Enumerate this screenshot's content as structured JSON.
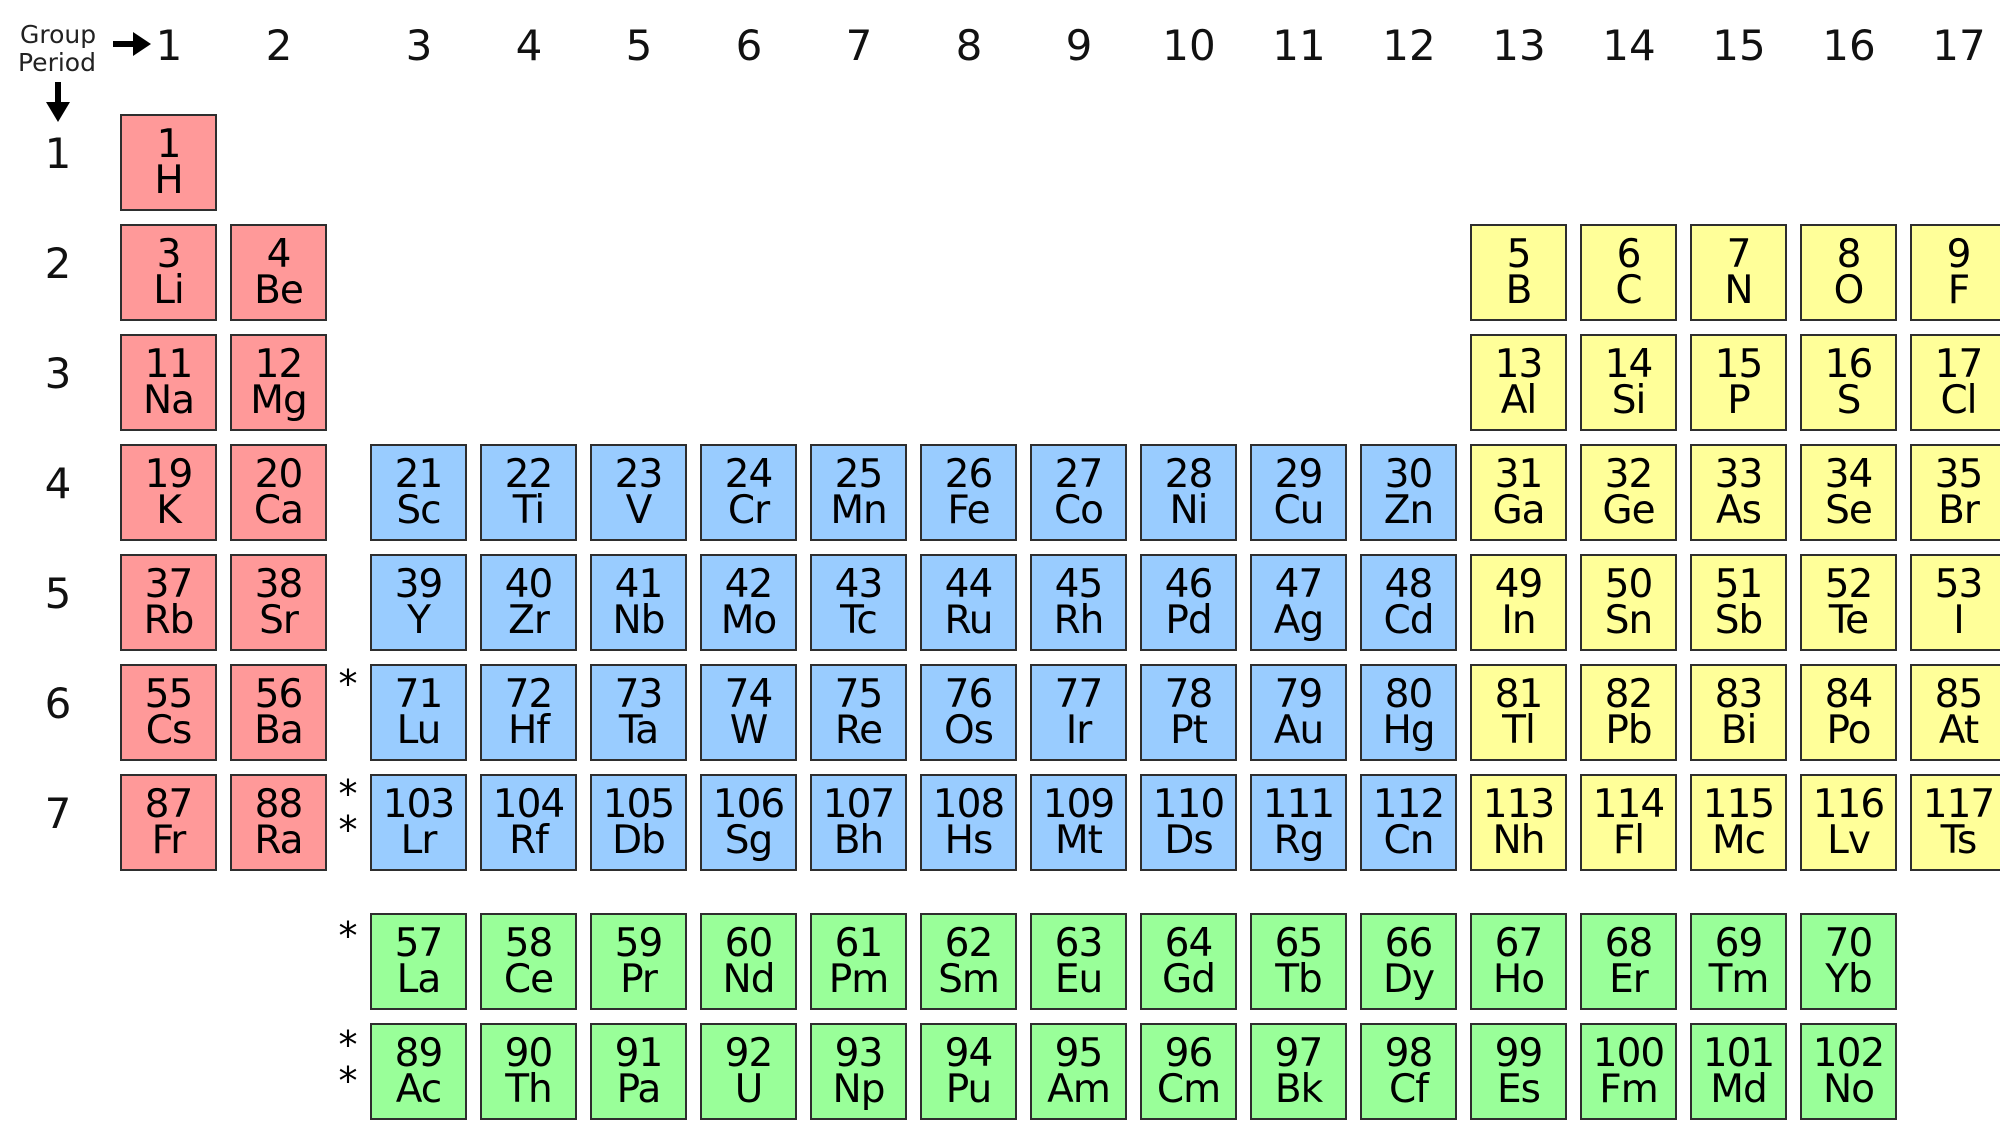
{
  "header": {
    "group_label": "Group",
    "period_label": "Period",
    "right_arrow_icon": "arrow-right-icon",
    "down_arrow_icon": "arrow-down-icon"
  },
  "colors": {
    "s_block": "#ff9999",
    "d_block": "#99ccff",
    "p_block": "#ffff99",
    "f_block": "#99ff99",
    "border": "#2e2e2e"
  },
  "groups": [
    "1",
    "2",
    "3",
    "4",
    "5",
    "6",
    "7",
    "8",
    "9",
    "10",
    "11",
    "12",
    "13",
    "14",
    "15",
    "16",
    "17"
  ],
  "periods": [
    "1",
    "2",
    "3",
    "4",
    "5",
    "6",
    "7"
  ],
  "markers": {
    "lanthanide": "*",
    "actinide": "**"
  },
  "elements": [
    {
      "n": "1",
      "s": "H",
      "g": 1,
      "p": 1,
      "b": "s"
    },
    {
      "n": "3",
      "s": "Li",
      "g": 1,
      "p": 2,
      "b": "s"
    },
    {
      "n": "4",
      "s": "Be",
      "g": 2,
      "p": 2,
      "b": "s"
    },
    {
      "n": "5",
      "s": "B",
      "g": 13,
      "p": 2,
      "b": "p"
    },
    {
      "n": "6",
      "s": "C",
      "g": 14,
      "p": 2,
      "b": "p"
    },
    {
      "n": "7",
      "s": "N",
      "g": 15,
      "p": 2,
      "b": "p"
    },
    {
      "n": "8",
      "s": "O",
      "g": 16,
      "p": 2,
      "b": "p"
    },
    {
      "n": "9",
      "s": "F",
      "g": 17,
      "p": 2,
      "b": "p"
    },
    {
      "n": "11",
      "s": "Na",
      "g": 1,
      "p": 3,
      "b": "s"
    },
    {
      "n": "12",
      "s": "Mg",
      "g": 2,
      "p": 3,
      "b": "s"
    },
    {
      "n": "13",
      "s": "Al",
      "g": 13,
      "p": 3,
      "b": "p"
    },
    {
      "n": "14",
      "s": "Si",
      "g": 14,
      "p": 3,
      "b": "p"
    },
    {
      "n": "15",
      "s": "P",
      "g": 15,
      "p": 3,
      "b": "p"
    },
    {
      "n": "16",
      "s": "S",
      "g": 16,
      "p": 3,
      "b": "p"
    },
    {
      "n": "17",
      "s": "Cl",
      "g": 17,
      "p": 3,
      "b": "p"
    },
    {
      "n": "19",
      "s": "K",
      "g": 1,
      "p": 4,
      "b": "s"
    },
    {
      "n": "20",
      "s": "Ca",
      "g": 2,
      "p": 4,
      "b": "s"
    },
    {
      "n": "21",
      "s": "Sc",
      "g": 3,
      "p": 4,
      "b": "d"
    },
    {
      "n": "22",
      "s": "Ti",
      "g": 4,
      "p": 4,
      "b": "d"
    },
    {
      "n": "23",
      "s": "V",
      "g": 5,
      "p": 4,
      "b": "d"
    },
    {
      "n": "24",
      "s": "Cr",
      "g": 6,
      "p": 4,
      "b": "d"
    },
    {
      "n": "25",
      "s": "Mn",
      "g": 7,
      "p": 4,
      "b": "d"
    },
    {
      "n": "26",
      "s": "Fe",
      "g": 8,
      "p": 4,
      "b": "d"
    },
    {
      "n": "27",
      "s": "Co",
      "g": 9,
      "p": 4,
      "b": "d"
    },
    {
      "n": "28",
      "s": "Ni",
      "g": 10,
      "p": 4,
      "b": "d"
    },
    {
      "n": "29",
      "s": "Cu",
      "g": 11,
      "p": 4,
      "b": "d"
    },
    {
      "n": "30",
      "s": "Zn",
      "g": 12,
      "p": 4,
      "b": "d"
    },
    {
      "n": "31",
      "s": "Ga",
      "g": 13,
      "p": 4,
      "b": "p"
    },
    {
      "n": "32",
      "s": "Ge",
      "g": 14,
      "p": 4,
      "b": "p"
    },
    {
      "n": "33",
      "s": "As",
      "g": 15,
      "p": 4,
      "b": "p"
    },
    {
      "n": "34",
      "s": "Se",
      "g": 16,
      "p": 4,
      "b": "p"
    },
    {
      "n": "35",
      "s": "Br",
      "g": 17,
      "p": 4,
      "b": "p"
    },
    {
      "n": "37",
      "s": "Rb",
      "g": 1,
      "p": 5,
      "b": "s"
    },
    {
      "n": "38",
      "s": "Sr",
      "g": 2,
      "p": 5,
      "b": "s"
    },
    {
      "n": "39",
      "s": "Y",
      "g": 3,
      "p": 5,
      "b": "d"
    },
    {
      "n": "40",
      "s": "Zr",
      "g": 4,
      "p": 5,
      "b": "d"
    },
    {
      "n": "41",
      "s": "Nb",
      "g": 5,
      "p": 5,
      "b": "d"
    },
    {
      "n": "42",
      "s": "Mo",
      "g": 6,
      "p": 5,
      "b": "d"
    },
    {
      "n": "43",
      "s": "Tc",
      "g": 7,
      "p": 5,
      "b": "d"
    },
    {
      "n": "44",
      "s": "Ru",
      "g": 8,
      "p": 5,
      "b": "d"
    },
    {
      "n": "45",
      "s": "Rh",
      "g": 9,
      "p": 5,
      "b": "d"
    },
    {
      "n": "46",
      "s": "Pd",
      "g": 10,
      "p": 5,
      "b": "d"
    },
    {
      "n": "47",
      "s": "Ag",
      "g": 11,
      "p": 5,
      "b": "d"
    },
    {
      "n": "48",
      "s": "Cd",
      "g": 12,
      "p": 5,
      "b": "d"
    },
    {
      "n": "49",
      "s": "In",
      "g": 13,
      "p": 5,
      "b": "p"
    },
    {
      "n": "50",
      "s": "Sn",
      "g": 14,
      "p": 5,
      "b": "p"
    },
    {
      "n": "51",
      "s": "Sb",
      "g": 15,
      "p": 5,
      "b": "p"
    },
    {
      "n": "52",
      "s": "Te",
      "g": 16,
      "p": 5,
      "b": "p"
    },
    {
      "n": "53",
      "s": "I",
      "g": 17,
      "p": 5,
      "b": "p"
    },
    {
      "n": "55",
      "s": "Cs",
      "g": 1,
      "p": 6,
      "b": "s"
    },
    {
      "n": "56",
      "s": "Ba",
      "g": 2,
      "p": 6,
      "b": "s"
    },
    {
      "n": "71",
      "s": "Lu",
      "g": 3,
      "p": 6,
      "b": "d"
    },
    {
      "n": "72",
      "s": "Hf",
      "g": 4,
      "p": 6,
      "b": "d"
    },
    {
      "n": "73",
      "s": "Ta",
      "g": 5,
      "p": 6,
      "b": "d"
    },
    {
      "n": "74",
      "s": "W",
      "g": 6,
      "p": 6,
      "b": "d"
    },
    {
      "n": "75",
      "s": "Re",
      "g": 7,
      "p": 6,
      "b": "d"
    },
    {
      "n": "76",
      "s": "Os",
      "g": 8,
      "p": 6,
      "b": "d"
    },
    {
      "n": "77",
      "s": "Ir",
      "g": 9,
      "p": 6,
      "b": "d"
    },
    {
      "n": "78",
      "s": "Pt",
      "g": 10,
      "p": 6,
      "b": "d"
    },
    {
      "n": "79",
      "s": "Au",
      "g": 11,
      "p": 6,
      "b": "d"
    },
    {
      "n": "80",
      "s": "Hg",
      "g": 12,
      "p": 6,
      "b": "d"
    },
    {
      "n": "81",
      "s": "Tl",
      "g": 13,
      "p": 6,
      "b": "p"
    },
    {
      "n": "82",
      "s": "Pb",
      "g": 14,
      "p": 6,
      "b": "p"
    },
    {
      "n": "83",
      "s": "Bi",
      "g": 15,
      "p": 6,
      "b": "p"
    },
    {
      "n": "84",
      "s": "Po",
      "g": 16,
      "p": 6,
      "b": "p"
    },
    {
      "n": "85",
      "s": "At",
      "g": 17,
      "p": 6,
      "b": "p"
    },
    {
      "n": "87",
      "s": "Fr",
      "g": 1,
      "p": 7,
      "b": "s"
    },
    {
      "n": "88",
      "s": "Ra",
      "g": 2,
      "p": 7,
      "b": "s"
    },
    {
      "n": "103",
      "s": "Lr",
      "g": 3,
      "p": 7,
      "b": "d"
    },
    {
      "n": "104",
      "s": "Rf",
      "g": 4,
      "p": 7,
      "b": "d"
    },
    {
      "n": "105",
      "s": "Db",
      "g": 5,
      "p": 7,
      "b": "d"
    },
    {
      "n": "106",
      "s": "Sg",
      "g": 6,
      "p": 7,
      "b": "d"
    },
    {
      "n": "107",
      "s": "Bh",
      "g": 7,
      "p": 7,
      "b": "d"
    },
    {
      "n": "108",
      "s": "Hs",
      "g": 8,
      "p": 7,
      "b": "d"
    },
    {
      "n": "109",
      "s": "Mt",
      "g": 9,
      "p": 7,
      "b": "d"
    },
    {
      "n": "110",
      "s": "Ds",
      "g": 10,
      "p": 7,
      "b": "d"
    },
    {
      "n": "111",
      "s": "Rg",
      "g": 11,
      "p": 7,
      "b": "d"
    },
    {
      "n": "112",
      "s": "Cn",
      "g": 12,
      "p": 7,
      "b": "d"
    },
    {
      "n": "113",
      "s": "Nh",
      "g": 13,
      "p": 7,
      "b": "p"
    },
    {
      "n": "114",
      "s": "Fl",
      "g": 14,
      "p": 7,
      "b": "p"
    },
    {
      "n": "115",
      "s": "Mc",
      "g": 15,
      "p": 7,
      "b": "p"
    },
    {
      "n": "116",
      "s": "Lv",
      "g": 16,
      "p": 7,
      "b": "p"
    },
    {
      "n": "117",
      "s": "Ts",
      "g": 17,
      "p": 7,
      "b": "p"
    },
    {
      "n": "57",
      "s": "La",
      "g": 3,
      "p": 8,
      "b": "f"
    },
    {
      "n": "58",
      "s": "Ce",
      "g": 4,
      "p": 8,
      "b": "f"
    },
    {
      "n": "59",
      "s": "Pr",
      "g": 5,
      "p": 8,
      "b": "f"
    },
    {
      "n": "60",
      "s": "Nd",
      "g": 6,
      "p": 8,
      "b": "f"
    },
    {
      "n": "61",
      "s": "Pm",
      "g": 7,
      "p": 8,
      "b": "f"
    },
    {
      "n": "62",
      "s": "Sm",
      "g": 8,
      "p": 8,
      "b": "f"
    },
    {
      "n": "63",
      "s": "Eu",
      "g": 9,
      "p": 8,
      "b": "f"
    },
    {
      "n": "64",
      "s": "Gd",
      "g": 10,
      "p": 8,
      "b": "f"
    },
    {
      "n": "65",
      "s": "Tb",
      "g": 11,
      "p": 8,
      "b": "f"
    },
    {
      "n": "66",
      "s": "Dy",
      "g": 12,
      "p": 8,
      "b": "f"
    },
    {
      "n": "67",
      "s": "Ho",
      "g": 13,
      "p": 8,
      "b": "f"
    },
    {
      "n": "68",
      "s": "Er",
      "g": 14,
      "p": 8,
      "b": "f"
    },
    {
      "n": "69",
      "s": "Tm",
      "g": 15,
      "p": 8,
      "b": "f"
    },
    {
      "n": "70",
      "s": "Yb",
      "g": 16,
      "p": 8,
      "b": "f"
    },
    {
      "n": "89",
      "s": "Ac",
      "g": 3,
      "p": 9,
      "b": "f"
    },
    {
      "n": "90",
      "s": "Th",
      "g": 4,
      "p": 9,
      "b": "f"
    },
    {
      "n": "91",
      "s": "Pa",
      "g": 5,
      "p": 9,
      "b": "f"
    },
    {
      "n": "92",
      "s": "U",
      "g": 6,
      "p": 9,
      "b": "f"
    },
    {
      "n": "93",
      "s": "Np",
      "g": 7,
      "p": 9,
      "b": "f"
    },
    {
      "n": "94",
      "s": "Pu",
      "g": 8,
      "p": 9,
      "b": "f"
    },
    {
      "n": "95",
      "s": "Am",
      "g": 9,
      "p": 9,
      "b": "f"
    },
    {
      "n": "96",
      "s": "Cm",
      "g": 10,
      "p": 9,
      "b": "f"
    },
    {
      "n": "97",
      "s": "Bk",
      "g": 11,
      "p": 9,
      "b": "f"
    },
    {
      "n": "98",
      "s": "Cf",
      "g": 12,
      "p": 9,
      "b": "f"
    },
    {
      "n": "99",
      "s": "Es",
      "g": 13,
      "p": 9,
      "b": "f"
    },
    {
      "n": "100",
      "s": "Fm",
      "g": 14,
      "p": 9,
      "b": "f"
    },
    {
      "n": "101",
      "s": "Md",
      "g": 15,
      "p": 9,
      "b": "f"
    },
    {
      "n": "102",
      "s": "No",
      "g": 16,
      "p": 9,
      "b": "f"
    }
  ]
}
